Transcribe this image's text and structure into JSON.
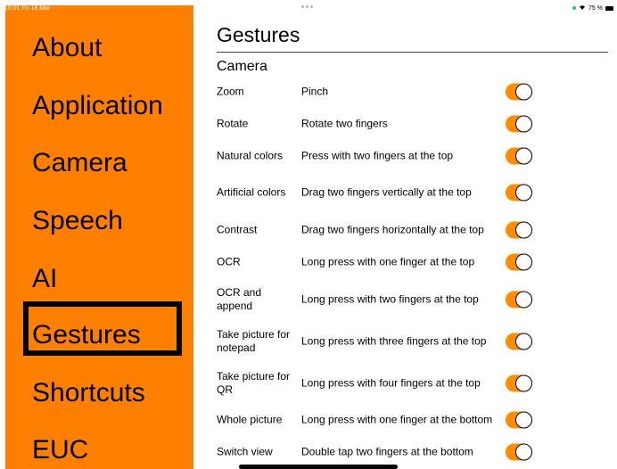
{
  "status_bar": {
    "time": "10:01  Fri 18 Mar",
    "battery_percent": "75 %"
  },
  "sidebar": {
    "accent_color": "#ff8000",
    "selected_index": 5,
    "items": [
      {
        "label": "About"
      },
      {
        "label": "Application"
      },
      {
        "label": "Camera"
      },
      {
        "label": "Speech"
      },
      {
        "label": "AI"
      },
      {
        "label": "Gestures"
      },
      {
        "label": "Shortcuts"
      },
      {
        "label": "EUC"
      }
    ]
  },
  "main": {
    "title": "Gestures",
    "section": "Camera",
    "toggle_color": "#ff8c00",
    "rows": [
      {
        "name": "Zoom",
        "gesture": "Pinch",
        "enabled": true
      },
      {
        "name": "Rotate",
        "gesture": "Rotate two fingers",
        "enabled": true
      },
      {
        "name": "Natural colors",
        "gesture": "Press with two fingers at the top",
        "enabled": true
      },
      {
        "name": "Artificial colors",
        "gesture": "Drag two fingers vertically at the top",
        "enabled": true
      },
      {
        "name": "Contrast",
        "gesture": "Drag two fingers horizontally at the top",
        "enabled": true
      },
      {
        "name": "OCR",
        "gesture": "Long press with one finger at the top",
        "enabled": true
      },
      {
        "name": "OCR and append",
        "gesture": "Long press with two fingers at the top",
        "enabled": true
      },
      {
        "name": "Take picture for notepad",
        "gesture": "Long press with three fingers at the top",
        "enabled": true
      },
      {
        "name": "Take picture for QR",
        "gesture": "Long press with four fingers at the top",
        "enabled": true
      },
      {
        "name": "Whole picture",
        "gesture": "Long press with one finger at the bottom",
        "enabled": true
      },
      {
        "name": "Switch view",
        "gesture": "Double tap two fingers at the bottom",
        "enabled": true
      }
    ]
  }
}
